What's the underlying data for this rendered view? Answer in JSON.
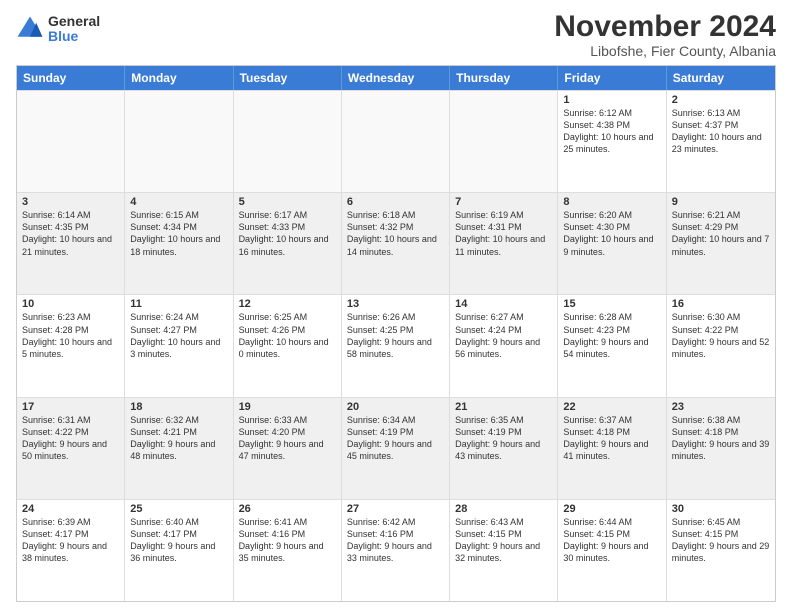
{
  "logo": {
    "general": "General",
    "blue": "Blue"
  },
  "title": "November 2024",
  "subtitle": "Libofshe, Fier County, Albania",
  "days": [
    "Sunday",
    "Monday",
    "Tuesday",
    "Wednesday",
    "Thursday",
    "Friday",
    "Saturday"
  ],
  "weeks": [
    [
      {
        "day": "",
        "info": ""
      },
      {
        "day": "",
        "info": ""
      },
      {
        "day": "",
        "info": ""
      },
      {
        "day": "",
        "info": ""
      },
      {
        "day": "",
        "info": ""
      },
      {
        "day": "1",
        "info": "Sunrise: 6:12 AM\nSunset: 4:38 PM\nDaylight: 10 hours and 25 minutes."
      },
      {
        "day": "2",
        "info": "Sunrise: 6:13 AM\nSunset: 4:37 PM\nDaylight: 10 hours and 23 minutes."
      }
    ],
    [
      {
        "day": "3",
        "info": "Sunrise: 6:14 AM\nSunset: 4:35 PM\nDaylight: 10 hours and 21 minutes."
      },
      {
        "day": "4",
        "info": "Sunrise: 6:15 AM\nSunset: 4:34 PM\nDaylight: 10 hours and 18 minutes."
      },
      {
        "day": "5",
        "info": "Sunrise: 6:17 AM\nSunset: 4:33 PM\nDaylight: 10 hours and 16 minutes."
      },
      {
        "day": "6",
        "info": "Sunrise: 6:18 AM\nSunset: 4:32 PM\nDaylight: 10 hours and 14 minutes."
      },
      {
        "day": "7",
        "info": "Sunrise: 6:19 AM\nSunset: 4:31 PM\nDaylight: 10 hours and 11 minutes."
      },
      {
        "day": "8",
        "info": "Sunrise: 6:20 AM\nSunset: 4:30 PM\nDaylight: 10 hours and 9 minutes."
      },
      {
        "day": "9",
        "info": "Sunrise: 6:21 AM\nSunset: 4:29 PM\nDaylight: 10 hours and 7 minutes."
      }
    ],
    [
      {
        "day": "10",
        "info": "Sunrise: 6:23 AM\nSunset: 4:28 PM\nDaylight: 10 hours and 5 minutes."
      },
      {
        "day": "11",
        "info": "Sunrise: 6:24 AM\nSunset: 4:27 PM\nDaylight: 10 hours and 3 minutes."
      },
      {
        "day": "12",
        "info": "Sunrise: 6:25 AM\nSunset: 4:26 PM\nDaylight: 10 hours and 0 minutes."
      },
      {
        "day": "13",
        "info": "Sunrise: 6:26 AM\nSunset: 4:25 PM\nDaylight: 9 hours and 58 minutes."
      },
      {
        "day": "14",
        "info": "Sunrise: 6:27 AM\nSunset: 4:24 PM\nDaylight: 9 hours and 56 minutes."
      },
      {
        "day": "15",
        "info": "Sunrise: 6:28 AM\nSunset: 4:23 PM\nDaylight: 9 hours and 54 minutes."
      },
      {
        "day": "16",
        "info": "Sunrise: 6:30 AM\nSunset: 4:22 PM\nDaylight: 9 hours and 52 minutes."
      }
    ],
    [
      {
        "day": "17",
        "info": "Sunrise: 6:31 AM\nSunset: 4:22 PM\nDaylight: 9 hours and 50 minutes."
      },
      {
        "day": "18",
        "info": "Sunrise: 6:32 AM\nSunset: 4:21 PM\nDaylight: 9 hours and 48 minutes."
      },
      {
        "day": "19",
        "info": "Sunrise: 6:33 AM\nSunset: 4:20 PM\nDaylight: 9 hours and 47 minutes."
      },
      {
        "day": "20",
        "info": "Sunrise: 6:34 AM\nSunset: 4:19 PM\nDaylight: 9 hours and 45 minutes."
      },
      {
        "day": "21",
        "info": "Sunrise: 6:35 AM\nSunset: 4:19 PM\nDaylight: 9 hours and 43 minutes."
      },
      {
        "day": "22",
        "info": "Sunrise: 6:37 AM\nSunset: 4:18 PM\nDaylight: 9 hours and 41 minutes."
      },
      {
        "day": "23",
        "info": "Sunrise: 6:38 AM\nSunset: 4:18 PM\nDaylight: 9 hours and 39 minutes."
      }
    ],
    [
      {
        "day": "24",
        "info": "Sunrise: 6:39 AM\nSunset: 4:17 PM\nDaylight: 9 hours and 38 minutes."
      },
      {
        "day": "25",
        "info": "Sunrise: 6:40 AM\nSunset: 4:17 PM\nDaylight: 9 hours and 36 minutes."
      },
      {
        "day": "26",
        "info": "Sunrise: 6:41 AM\nSunset: 4:16 PM\nDaylight: 9 hours and 35 minutes."
      },
      {
        "day": "27",
        "info": "Sunrise: 6:42 AM\nSunset: 4:16 PM\nDaylight: 9 hours and 33 minutes."
      },
      {
        "day": "28",
        "info": "Sunrise: 6:43 AM\nSunset: 4:15 PM\nDaylight: 9 hours and 32 minutes."
      },
      {
        "day": "29",
        "info": "Sunrise: 6:44 AM\nSunset: 4:15 PM\nDaylight: 9 hours and 30 minutes."
      },
      {
        "day": "30",
        "info": "Sunrise: 6:45 AM\nSunset: 4:15 PM\nDaylight: 9 hours and 29 minutes."
      }
    ]
  ]
}
